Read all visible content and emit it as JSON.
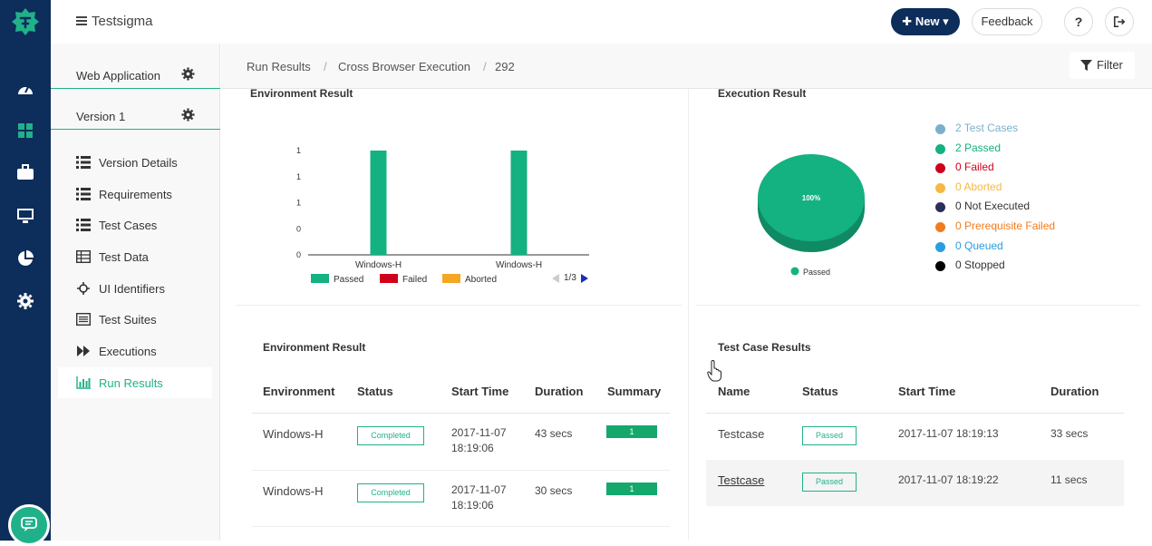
{
  "app": {
    "brand": "Testsigma",
    "new_label": "New",
    "feedback_label": "Feedback",
    "help_label": "?",
    "accent": "#21b18a",
    "navy": "#0d2d5a"
  },
  "sidebar": {
    "project": "Web Application",
    "version": "Version 1",
    "items": [
      {
        "label": "Version Details",
        "icon": "list-icon"
      },
      {
        "label": "Requirements",
        "icon": "list-icon"
      },
      {
        "label": "Test Cases",
        "icon": "list-icon"
      },
      {
        "label": "Test Data",
        "icon": "table-icon"
      },
      {
        "label": "UI Identifiers",
        "icon": "crosshair-icon"
      },
      {
        "label": "Test Suites",
        "icon": "suite-icon"
      },
      {
        "label": "Executions",
        "icon": "fast-forward-icon"
      },
      {
        "label": "Run Results",
        "icon": "bar-chart-icon",
        "active": true
      }
    ]
  },
  "breadcrumb": {
    "items": [
      "Run Results",
      "Cross Browser Execution",
      "292"
    ],
    "separator": "/"
  },
  "filter_label": "Filter",
  "environment_chart": {
    "title": "Environment Result",
    "pagination": "1/3"
  },
  "chart_data": {
    "type": "bar",
    "categories": [
      "Windows-H",
      "Windows-H"
    ],
    "series": [
      {
        "name": "Passed",
        "values": [
          1,
          1
        ],
        "color": "#14b181"
      },
      {
        "name": "Failed",
        "values": [
          0,
          0
        ],
        "color": "#d0021b"
      },
      {
        "name": "Aborted",
        "values": [
          0,
          0
        ],
        "color": "#f5a623"
      }
    ],
    "y_ticks": [
      "0",
      "0",
      "1",
      "1",
      "1"
    ],
    "ylim": [
      0,
      1
    ]
  },
  "execution_result": {
    "title": "Execution Result",
    "pie_label": "100%",
    "pie_legend": "Passed",
    "legend": [
      {
        "text": "2 Test Cases",
        "color": "#7bb0cc",
        "text_color": "#7bb0cc"
      },
      {
        "text": "2 Passed",
        "color": "#14b181",
        "text_color": "#14b181"
      },
      {
        "text": "0 Failed",
        "color": "#d0021b",
        "text_color": "#d0021b"
      },
      {
        "text": "0 Aborted",
        "color": "#f5b942",
        "text_color": "#f5b942"
      },
      {
        "text": "0 Not Executed",
        "color": "#2d2d5e",
        "text_color": "#333333"
      },
      {
        "text": "0 Prerequisite Failed",
        "color": "#f07c1e",
        "text_color": "#f07c1e"
      },
      {
        "text": "0 Queued",
        "color": "#2a9de0",
        "text_color": "#2a9de0"
      },
      {
        "text": "0 Stopped",
        "color": "#000000",
        "text_color": "#333333"
      }
    ]
  },
  "env_table": {
    "title": "Environment Result",
    "headers": [
      "Environment",
      "Status",
      "Start Time",
      "Duration",
      "Summary"
    ],
    "rows": [
      {
        "environment": "Windows-H",
        "status": "Completed",
        "start_date": "2017-11-07",
        "start_time": "18:19:06",
        "duration": "43 secs",
        "summary": "1"
      },
      {
        "environment": "Windows-H",
        "status": "Completed",
        "start_date": "2017-11-07",
        "start_time": "18:19:06",
        "duration": "30 secs",
        "summary": "1"
      }
    ]
  },
  "tc_table": {
    "title": "Test Case Results",
    "headers": [
      "Name",
      "Status",
      "Start Time",
      "Duration"
    ],
    "rows": [
      {
        "name": "Testcase",
        "status": "Passed",
        "start": "2017-11-07 18:19:13",
        "duration": "33 secs"
      },
      {
        "name": "Testcase",
        "status": "Passed",
        "start": "2017-11-07 18:19:22",
        "duration": "11 secs"
      }
    ]
  }
}
